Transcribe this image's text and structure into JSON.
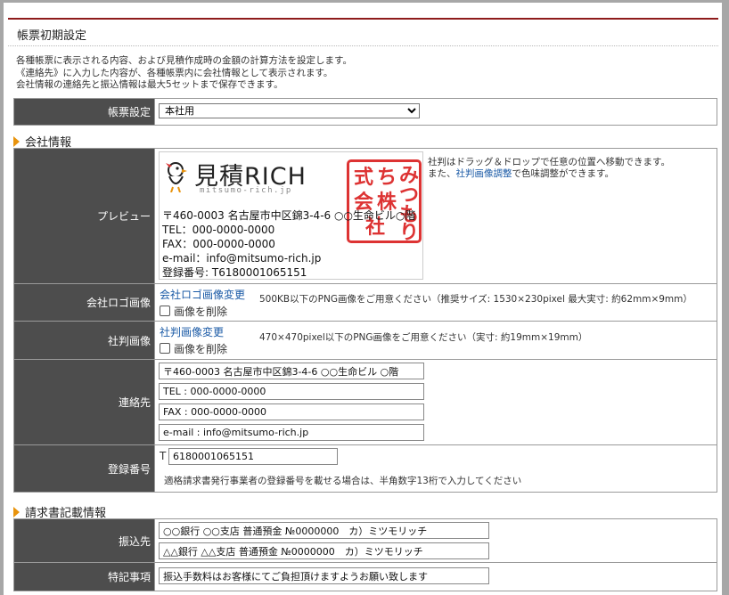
{
  "page": {
    "title": "帳票初期設定"
  },
  "description": [
    "各種帳票に表示される内容、および見積作成時の金額の計算方法を設定します。",
    "《連絡先》に入力した内容が、各種帳票内に会社情報として表示されます。",
    "会社情報の連絡先と振込情報は最大5セットまで保存できます。"
  ],
  "form_setting": {
    "label": "帳票設定",
    "selected": "本社用"
  },
  "company_section": {
    "title": "会社情報",
    "preview_label": "プレビュー",
    "logo": {
      "main": "見積RICH",
      "sub": "mitsumo-rich.jp"
    },
    "stamp": {
      "chars": [
        "み",
        "つ",
        "も",
        "り",
        "ち",
        "株",
        "式",
        "会",
        "社"
      ]
    },
    "preview_lines": [
      "〒460-0003 名古屋市中区錦3-4-6 ○○生命ビル○階",
      "TEL：000-0000-0000",
      "FAX：000-0000-0000",
      "e-mail：info@mitsumo-rich.jp",
      "登録番号: T6180001065151"
    ],
    "note_line1": "社判はドラッグ＆ドロップで任意の位置へ移動できます。",
    "note_line2_pre": "また、",
    "note_line2_link": "社判画像調整",
    "note_line2_post": "で色味調整ができます。",
    "logo_row": {
      "label": "会社ロゴ画像",
      "link": "会社ロゴ画像変更",
      "delete": "画像を削除",
      "hint": "500KB以下のPNG画像をご用意ください（推奨サイズ: 1530×230pixel 最大実寸: 約62mm×9mm）"
    },
    "stamp_row": {
      "label": "社判画像",
      "link": "社判画像変更",
      "delete": "画像を削除",
      "hint": "470×470pixel以下のPNG画像をご用意ください（実寸: 約19mm×19mm）"
    },
    "contact_row": {
      "label": "連絡先",
      "values": [
        "〒460-0003 名古屋市中区錦3-4-6 ○○生命ビル ○階",
        "TEL : 000-0000-0000",
        "FAX : 000-0000-0000",
        "e-mail : info@mitsumo-rich.jp"
      ]
    },
    "reg_row": {
      "label": "登録番号",
      "prefix": "T",
      "value": "6180001065151",
      "hint": "適格請求書発行事業者の登録番号を載せる場合は、半角数字13桁で入力してください"
    }
  },
  "invoice_section": {
    "title": "請求書記載情報",
    "bank_row": {
      "label": "振込先",
      "values": [
        "○○銀行 ○○支店 普通預金 №0000000　カ）ミツモリッチ",
        "△△銀行 △△支店 普通預金 №0000000　カ）ミツモリッチ"
      ]
    },
    "special_row": {
      "label": "特記事項",
      "value": "振込手数料はお客様にてご負担頂けますようお願い致します"
    }
  }
}
